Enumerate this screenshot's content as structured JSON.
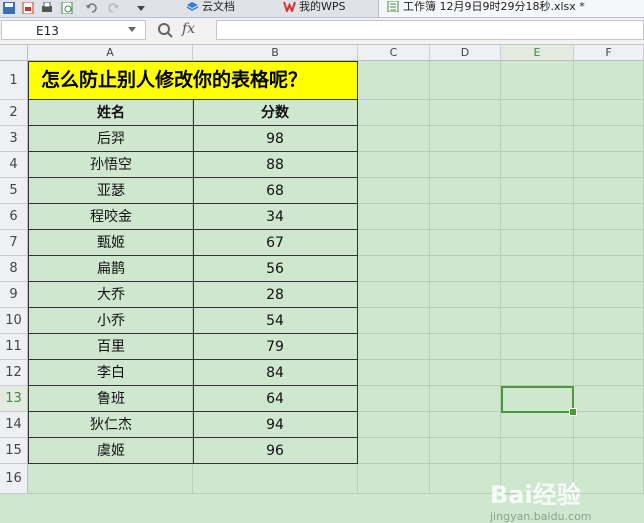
{
  "tabs": [
    {
      "label": "云文档",
      "active": false
    },
    {
      "label": "我的WPS",
      "active": false
    },
    {
      "label": "工作簿 12月9日9时29分18秒.xlsx *",
      "active": true
    }
  ],
  "formula_bar": {
    "cell_ref": "E13",
    "fx_label": "fx",
    "value": ""
  },
  "columns": [
    "A",
    "B",
    "C",
    "D",
    "E",
    "F"
  ],
  "selected": {
    "column": "E",
    "row": 13
  },
  "rows": [
    "1",
    "2",
    "3",
    "4",
    "5",
    "6",
    "7",
    "8",
    "9",
    "10",
    "11",
    "12",
    "13",
    "14",
    "15",
    "16"
  ],
  "sheet": {
    "title": "怎么防止别人修改你的表格呢？",
    "header": {
      "name": "姓名",
      "score": "分数"
    },
    "records": [
      {
        "name": "后羿",
        "score": "98"
      },
      {
        "name": "孙悟空",
        "score": "88"
      },
      {
        "name": "亚瑟",
        "score": "68"
      },
      {
        "name": "程咬金",
        "score": "34"
      },
      {
        "name": "甄姬",
        "score": "67"
      },
      {
        "name": "扁鹊",
        "score": "56"
      },
      {
        "name": "大乔",
        "score": "28"
      },
      {
        "name": "小乔",
        "score": "54"
      },
      {
        "name": "百里",
        "score": "79"
      },
      {
        "name": "李白",
        "score": "84"
      },
      {
        "name": "鲁班",
        "score": "64"
      },
      {
        "name": "狄仁杰",
        "score": "94"
      },
      {
        "name": "虞姬",
        "score": "96"
      }
    ]
  },
  "watermark": {
    "logo": "Bai经验",
    "sub": "jingyan.baidu.com"
  },
  "colors": {
    "sheet_bg": "#cfe6cf",
    "title_bg": "#ffff00",
    "selection": "#4a9a3a"
  }
}
